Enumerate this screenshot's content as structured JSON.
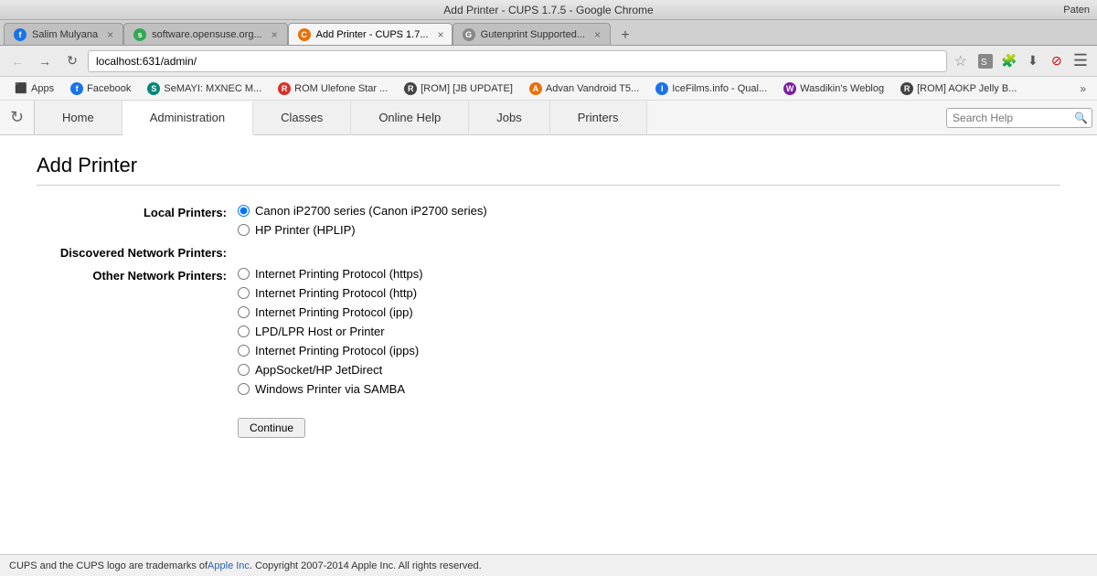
{
  "titleBar": {
    "title": "Add Printer - CUPS 1.7.5 - Google Chrome",
    "paten": "Paten"
  },
  "tabs": [
    {
      "id": "tab1",
      "label": "Salim Mulyana",
      "favicon": "F",
      "faviconColor": "fav-blue",
      "active": false
    },
    {
      "id": "tab2",
      "label": "software.opensuse.org",
      "favicon": "S",
      "faviconColor": "fav-green",
      "active": false
    },
    {
      "id": "tab3",
      "label": "Add Printer - CUPS 1.7...",
      "favicon": "C",
      "faviconColor": "fav-orange",
      "active": true
    },
    {
      "id": "tab4",
      "label": "Gutenprint Supported...",
      "favicon": "G",
      "faviconColor": "fav-gray",
      "active": false
    }
  ],
  "addressBar": {
    "url": "localhost:631/admin/"
  },
  "bookmarks": [
    {
      "id": "bk-apps",
      "label": "Apps",
      "favicon": "▦",
      "hasFavicon": true
    },
    {
      "id": "bk-facebook",
      "label": "Facebook",
      "favicon": "f",
      "hasFavicon": true
    },
    {
      "id": "bk-semayi",
      "label": "SeMAYI: MXNEC M...",
      "favicon": "S",
      "hasFavicon": true
    },
    {
      "id": "bk-rom-ulefone",
      "label": "ROM Ulefone Star ...",
      "favicon": "R",
      "hasFavicon": true
    },
    {
      "id": "bk-rom-jb",
      "label": "[ROM] [JB UPDATE]",
      "favicon": "R",
      "hasFavicon": true
    },
    {
      "id": "bk-advan",
      "label": "Advan Vandroid T5...",
      "favicon": "A",
      "hasFavicon": true
    },
    {
      "id": "bk-icefilms",
      "label": "IceFilms.info - Qual...",
      "favicon": "I",
      "hasFavicon": true
    },
    {
      "id": "bk-wasdikin",
      "label": "Wasdikin's Weblog",
      "favicon": "W",
      "hasFavicon": true
    },
    {
      "id": "bk-rom-aokp",
      "label": "[ROM] AOKP Jelly B...",
      "favicon": "R",
      "hasFavicon": true
    }
  ],
  "cupsNav": {
    "tabs": [
      {
        "id": "nav-home",
        "label": "Home",
        "active": false
      },
      {
        "id": "nav-administration",
        "label": "Administration",
        "active": true
      },
      {
        "id": "nav-classes",
        "label": "Classes",
        "active": false
      },
      {
        "id": "nav-online-help",
        "label": "Online Help",
        "active": false
      },
      {
        "id": "nav-jobs",
        "label": "Jobs",
        "active": false
      },
      {
        "id": "nav-printers",
        "label": "Printers",
        "active": false
      }
    ],
    "searchPlaceholder": "Search Help"
  },
  "page": {
    "title": "Add Printer",
    "sections": {
      "localPrinters": {
        "label": "Local Printers:",
        "options": [
          {
            "id": "lp1",
            "label": "Canon iP2700 series (Canon iP2700 series)",
            "checked": true
          },
          {
            "id": "lp2",
            "label": "HP Printer (HPLIP)",
            "checked": false
          }
        ]
      },
      "discoveredNetwork": {
        "label": "Discovered Network Printers:",
        "options": []
      },
      "otherNetwork": {
        "label": "Other Network Printers:",
        "options": [
          {
            "id": "on1",
            "label": "Internet Printing Protocol (https)",
            "checked": false
          },
          {
            "id": "on2",
            "label": "Internet Printing Protocol (http)",
            "checked": false
          },
          {
            "id": "on3",
            "label": "Internet Printing Protocol (ipp)",
            "checked": false
          },
          {
            "id": "on4",
            "label": "LPD/LPR Host or Printer",
            "checked": false
          },
          {
            "id": "on5",
            "label": "Internet Printing Protocol (ipps)",
            "checked": false
          },
          {
            "id": "on6",
            "label": "AppSocket/HP JetDirect",
            "checked": false
          },
          {
            "id": "on7",
            "label": "Windows Printer via SAMBA",
            "checked": false
          }
        ]
      }
    },
    "continueButton": "Continue"
  },
  "footer": {
    "text1": "CUPS and the CUPS logo are trademarks of ",
    "linkText": "Apple Inc",
    "text2": ". Copyright 2007-2014 Apple Inc. All rights reserved."
  }
}
